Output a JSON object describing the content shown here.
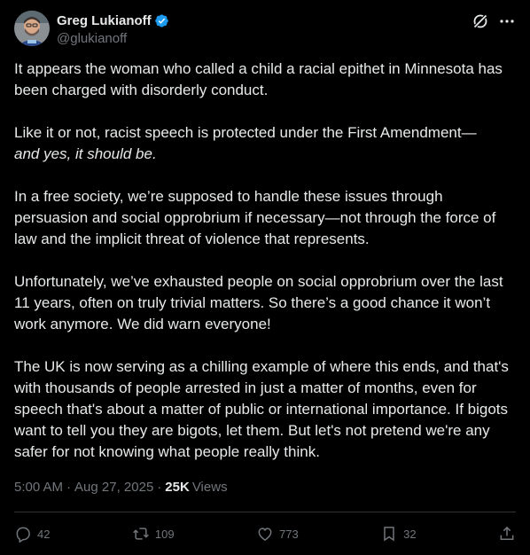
{
  "author": {
    "display_name": "Greg Lukianoff",
    "handle": "@glukianoff",
    "verified": true,
    "verified_color": "#1d9bf0"
  },
  "header_icons": {
    "grok": "grok-icon",
    "more": "more-icon"
  },
  "tweet": {
    "paragraphs": [
      {
        "text": "It appears the woman who called a child a racial epithet in Minnesota has been charged with disorderly conduct."
      },
      {
        "text": "Like it or not, racist speech is protected under the First Amendment—",
        "emphasis": "and yes, it should be."
      },
      {
        "text": "In a free society, we’re supposed to handle these issues through persuasion and social opprobrium if necessary—not through the force of law and the implicit threat of violence that represents."
      },
      {
        "text": "Unfortunately, we’ve exhausted people on social opprobrium over the last 11 years, often on truly trivial matters. So there’s a good chance it won’t work anymore. We did warn everyone!"
      },
      {
        "text": "The UK is now serving as a chilling example of where this ends, and that's with thousands of people arrested in just a matter of months, even for speech that's about a matter of public or international importance. If bigots want to tell you they are bigots, let them. But let's not pretend we're any safer for not knowing what people really think."
      }
    ]
  },
  "meta": {
    "time": "5:00 AM",
    "separator": "·",
    "date": "Aug 27, 2025",
    "views_count": "25K",
    "views_label": "Views"
  },
  "actions": {
    "replies": "42",
    "reposts": "109",
    "likes": "773",
    "bookmarks": "32"
  },
  "colors": {
    "background": "#000000",
    "text": "#e7e9ea",
    "muted": "#71767b",
    "divider": "#2f3336"
  }
}
